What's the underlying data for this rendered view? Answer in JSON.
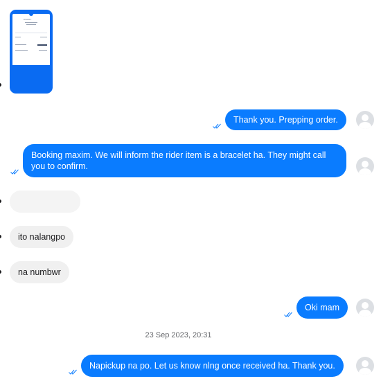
{
  "messages": {
    "out_1": "Thank you. Prepping order.",
    "out_2": "Booking maxim. We will inform the rider item is a bracelet ha. They might call you to confirm.",
    "in_1": "ito nalangpo",
    "in_2": "na numbwr",
    "out_3": "Oki mam",
    "out_4": "Napickup na po. Let us know nlng once received ha. Thank you."
  },
  "timestamp": "23 Sep 2023, 20:31",
  "colors": {
    "outgoing_bubble": "#0a7cff",
    "incoming_bubble": "#f0f0f0",
    "receipt_background": "#0a6bf2"
  },
  "icons": {
    "read_receipt": "double-check-icon",
    "avatar": "user-avatar-icon"
  }
}
